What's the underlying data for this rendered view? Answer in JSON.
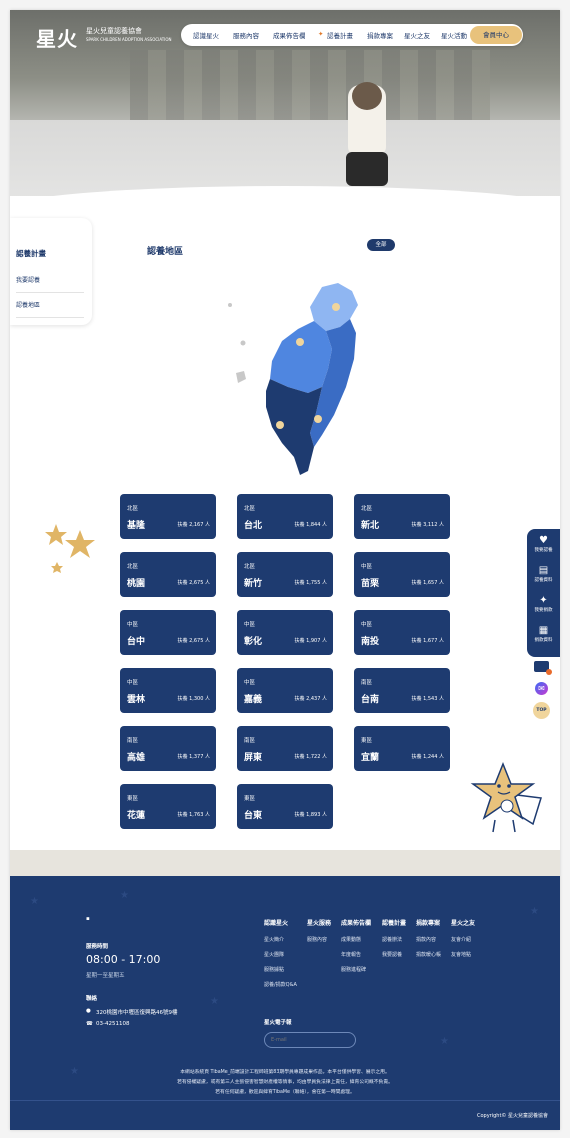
{
  "brand": {
    "logo_text": "星火",
    "org_name": "星火兒童認養協會",
    "org_name_en": "SPARK CHILDREN ADOPTION ASSOCIATION"
  },
  "nav": {
    "items": [
      "認識星火",
      "服務內容",
      "成果佈告欄",
      "認養計畫",
      "捐款專案",
      "星火之友",
      "星火活動"
    ],
    "member_button": "會員中心"
  },
  "sidebar": {
    "title": "認養計畫",
    "items": [
      "我要認養",
      "認養地區"
    ]
  },
  "main": {
    "title": "認養地區",
    "filter_button": "全部"
  },
  "regions": [
    {
      "region": "北區",
      "city": "基隆",
      "count": "扶養 2,167 人"
    },
    {
      "region": "北區",
      "city": "台北",
      "count": "扶養 1,844 人"
    },
    {
      "region": "北區",
      "city": "新北",
      "count": "扶養 3,112 人"
    },
    {
      "region": "北區",
      "city": "桃園",
      "count": "扶養 2,675 人"
    },
    {
      "region": "北區",
      "city": "新竹",
      "count": "扶養 1,755 人"
    },
    {
      "region": "中區",
      "city": "苗栗",
      "count": "扶養 1,657 人"
    },
    {
      "region": "中區",
      "city": "台中",
      "count": "扶養 2,675 人"
    },
    {
      "region": "中區",
      "city": "彰化",
      "count": "扶養 1,907 人"
    },
    {
      "region": "中區",
      "city": "南投",
      "count": "扶養 1,677 人"
    },
    {
      "region": "中區",
      "city": "雲林",
      "count": "扶養 1,300 人"
    },
    {
      "region": "中區",
      "city": "嘉義",
      "count": "扶養 2,437 人"
    },
    {
      "region": "南區",
      "city": "台南",
      "count": "扶養 1,543 人"
    },
    {
      "region": "南區",
      "city": "高雄",
      "count": "扶養 1,377 人"
    },
    {
      "region": "南區",
      "city": "屏東",
      "count": "扶養 1,722 人"
    },
    {
      "region": "東區",
      "city": "宜蘭",
      "count": "扶養 1,244 人"
    },
    {
      "region": "東區",
      "city": "花蓮",
      "count": "扶養 1,763 人"
    },
    {
      "region": "東區",
      "city": "台東",
      "count": "扶養 1,893 人"
    }
  ],
  "float_menu": [
    {
      "icon": "heart-chat-icon",
      "label": "我要認養"
    },
    {
      "icon": "form-icon",
      "label": "認養資料"
    },
    {
      "icon": "donate-icon",
      "label": "我要捐款"
    },
    {
      "icon": "doc-icon",
      "label": "捐款資料"
    }
  ],
  "top_button": "TOP",
  "footer": {
    "hours_label": "服務時間",
    "hours": "08:00 - 17:00",
    "hours_note": "星期一至星期五",
    "contact_label": "聯絡",
    "address": "320桃園市中壢區復興路46號9樓",
    "phone": "03-4251108",
    "columns": [
      {
        "title": "認識星火",
        "items": [
          "星火簡介",
          "星火團隊",
          "服務據點",
          "認養/捐款Q&A"
        ]
      },
      {
        "title": "星火服務",
        "items": [
          "服務內容"
        ]
      },
      {
        "title": "成果佈告欄",
        "items": [
          "成果動態",
          "年度報告",
          "服務進程碑"
        ]
      },
      {
        "title": "認養計畫",
        "items": [
          "認養辦法",
          "我要認養"
        ]
      },
      {
        "title": "捐款專案",
        "items": [
          "捐款內容",
          "捐款暖心帳"
        ]
      },
      {
        "title": "星火之友",
        "items": [
          "友會介紹",
          "友會地點"
        ]
      }
    ],
    "newsletter_label": "星火電子報",
    "email_placeholder": "E-mail",
    "disclaimer": [
      "本網站系統頁 TibaMe_前端設計工程師班第83期學員專題成果作品，本平台僅供學習、展示之用。",
      "若有侵權疑慮，或有第三人主張侵害智慧財產權等情事，均由學員負法律上責任，緯育公司概不負責。",
      "若有任何疑慮，歡迎與緯育TibaMe（聯絡），會在第一時間處理。"
    ],
    "copyright": "Copyright© 星火兒童認養協會"
  },
  "colors": {
    "primary": "#1e3b70",
    "accent": "#e8c27c",
    "map_light": "#8fb6f2",
    "map_mid": "#4f86e0",
    "map_dark": "#1e3b70"
  }
}
